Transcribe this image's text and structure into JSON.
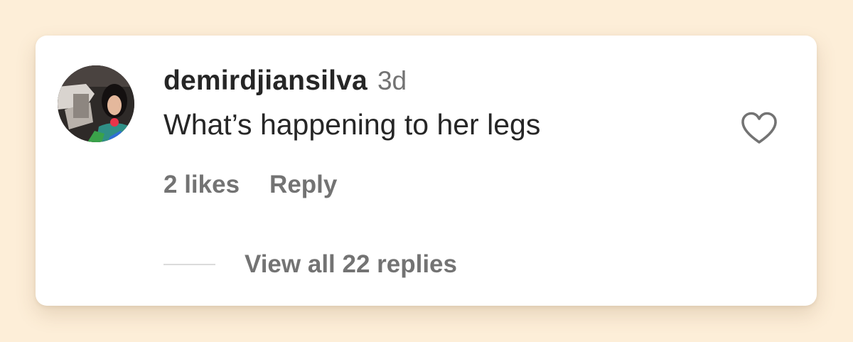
{
  "comment": {
    "username": "demirdjiansilva",
    "timestamp": "3d",
    "text": "What’s happening to her legs",
    "likes_label": "2 likes",
    "reply_label": "Reply",
    "view_replies_label": "View all 22 replies",
    "avatar_icon": "user-avatar-photo",
    "like_icon": "heart-outline-icon"
  },
  "colors": {
    "page_background": "#fdeed8",
    "card_background": "#ffffff",
    "primary_text": "#262626",
    "secondary_text": "#737373",
    "divider": "#dbdbdb"
  }
}
